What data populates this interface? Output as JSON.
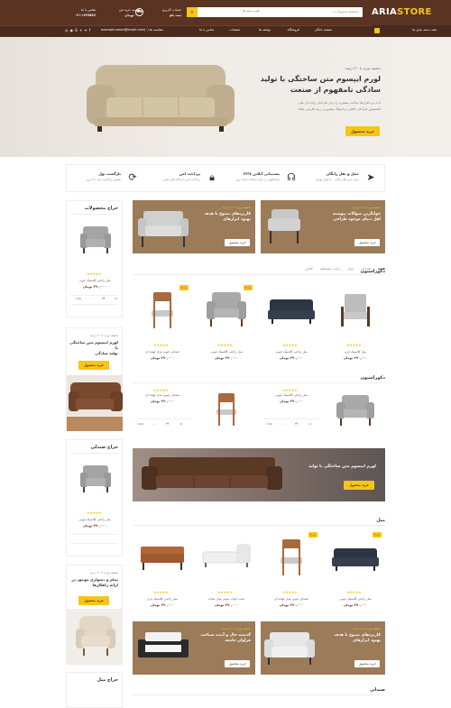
{
  "header": {
    "logo_a": "ARIA",
    "logo_b": "STORE",
    "search_placeholder": "جستجو محصولات...",
    "search_category": "همه دسته ها",
    "account_label": "حساب کاربری",
    "account_sub": "ثبت نام",
    "cart_label": "سبد خرید من",
    "cart_value": "۰ تومان",
    "phone_label": "تماس با ما",
    "phone_value": "۰۲۱-۱۲۳۴۵۶۷"
  },
  "nav": {
    "categories_label": "همه دسته بندی ها",
    "items": [
      "صفحه خانگی",
      "فروشگاه",
      "نوشته ها",
      "صفحات",
      "تماس با ما"
    ],
    "email": "example.store@email.com",
    "compare": "مقایسه ها (۰)"
  },
  "hero": {
    "kicker": "تخفیف ویژه تا ۳۰ درصد",
    "title_line1": "لورم ایپسوم متن ساختگی با تولید",
    "title_line2": "سادگی نامفهوم از صنعت",
    "desc_line1": "تا با نرم افزارها شناخت بیشتری را برای طراحان رایانه ای علی",
    "desc_line2": "الخصوص طراحان خلاقی، و فرهنگ پیشرو در زبان فارسی ایجاد",
    "button": "خرید محصول"
  },
  "features": [
    {
      "title": "حمل و نقل رایگان",
      "desc": "برای خرید های بالای ۵۰۰ هزار تومان"
    },
    {
      "title": "پشتیبانی آنلاین ۲۴/۷",
      "desc": "پاسخگویی در تمام ساعات شبانه روز"
    },
    {
      "title": "پرداخت امن",
      "desc": "پرداخت امن با درگاه های معتبر"
    },
    {
      "title": "بازگشت پول",
      "desc": "تضمین بازگشت وجه تا ۷ روز"
    }
  ],
  "promo_top": [
    {
      "kicker": "تخفیف ویژه تا ۲۰ درصد",
      "line1": "جوایگزین سوالات پیوسته",
      "line2": "اهل دنیای موجود طراحی",
      "button": "خرید محصول"
    },
    {
      "kicker": "تخفیف ویژه تا ۲۰ درصد",
      "line1": "کاربردهای متنوع با هدف",
      "line2": "بهبود ابزارهای",
      "button": "خرید محصول"
    }
  ],
  "tabs": [
    "همه",
    "صندلی",
    "مبل",
    "زانت زمستانه",
    "کتابی"
  ],
  "section1_title": "دکوراسیون",
  "row1": [
    {
      "name": "مبل کلاسیک چرم",
      "price": "۲۹۰,۰۰۰ تومان"
    },
    {
      "name": "مبل راحتی کلاسیک چوبی",
      "price": "۲۹۰,۰۰۰ تومان"
    },
    {
      "name": "مبل راحتی کلاسیک چوبی",
      "price": "۲۹۰,۰۰۰ تومان"
    },
    {
      "name": "صندلی چوبی مدل لهجه ای",
      "price": "۲۹۰,۰۰۰ تومان"
    }
  ],
  "section2_title": "دکوراسیون",
  "row2": [
    {
      "name": "مبل راحتی کلاسیک چوبی",
      "price": "۳۹۰,۰۰۰ تومان"
    },
    {
      "name": "مبل راحتی کلاسیک چوبی",
      "price": "۳۹۰,۰۰۰ تومان"
    },
    {
      "name": "صندلی چوبی مدل لهجه ای",
      "price": "۲۹۰,۰۰۰ تومان"
    }
  ],
  "countdown": [
    "۱۶۸۸",
    "۰۰",
    "۳۴",
    "۱۸"
  ],
  "countdown_labels": [
    "روز",
    "ساعت",
    "دقیقه",
    "ثانیه"
  ],
  "wide_banner": {
    "text": "لورم ایپسوم متن ساختگی با تولید",
    "button": "خرید محصول"
  },
  "section3_title": "مبل",
  "row3": [
    {
      "name": "مبل راحتی کلاسیک چوبی",
      "price": "۳۹۰,۰۰۰ تومان"
    },
    {
      "name": "صندلی چوبی مدل لهجه ای",
      "price": "۲۹۰,۰۰۰ تومان"
    },
    {
      "name": "تخت خواب چوبی مدل ساده",
      "price": "۲۹۰,۰۰۰ تومان"
    },
    {
      "name": "مبل راحتی کلاسیک چرم",
      "price": "۲۹۰,۰۰۰ تومان"
    }
  ],
  "promo_bottom": [
    {
      "kicker": "تخفیف ویژه تا ۲۰ درصد",
      "line1": "کاربردهای متنوع با هدف",
      "line2": "بهبود ابزارهای",
      "button": "خرید محصول"
    },
    {
      "kicker": "تخفیف ویژه تا ۲۰ درصد",
      "line1": "گذشته حال و آینده شناخت",
      "line2": "فراوان جامعه",
      "button": "خرید محصول"
    }
  ],
  "section4_title": "صندلی",
  "sidebar": {
    "auction1_title": "حراج محصولات",
    "auction1_name": "مبل راحتی کلاسیک چوبی",
    "auction1_price": "۳۹۰,۰۰۰ تومان",
    "ad1_kicker": "تخفیف ویژه تا ۳۰ درصد",
    "ad1_title1": "لورم ایپسوم متن ساختگی با",
    "ad1_title2": "تولید سادگی",
    "ad1_button": "خرید محصول",
    "auction2_title": "حراج صندلی",
    "auction2_name": "مبل راحتی کلاسیک چوبی",
    "auction2_price": "۳۹۰,۰۰۰ تومان",
    "ad2_kicker": "تخفیف ویژه تا ۳۰ درصد",
    "ad2_title1": "تمام و دشواری موجود در",
    "ad2_title2": "ارائه راهکارها",
    "ad2_button": "خرید محصول",
    "auction3_title": "حراج مبل"
  },
  "colors": {
    "brown": "#5a3322",
    "yellow": "#f5c518",
    "tan": "#9b7b58"
  }
}
